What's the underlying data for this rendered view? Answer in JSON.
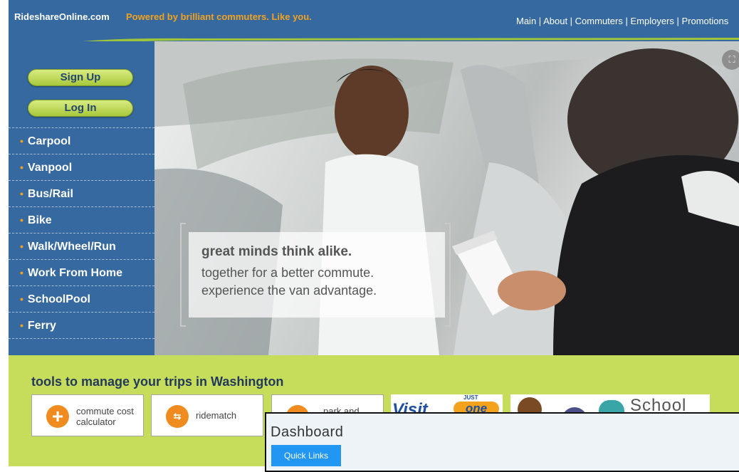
{
  "header": {
    "site_name": "RideshareOnline.com",
    "tagline": "Powered by brilliant commuters. Like you.",
    "nav": [
      "Main",
      "About",
      "Commuters",
      "Employers",
      "Promotions"
    ],
    "separator": " | "
  },
  "sidebar": {
    "sign_up": "Sign Up",
    "log_in": "Log In",
    "bullet": "•",
    "items": [
      "Carpool",
      "Vanpool",
      "Bus/Rail",
      "Bike",
      "Walk/Wheel/Run",
      "Work From Home",
      "SchoolPool",
      "Ferry"
    ]
  },
  "hero": {
    "line1": "great minds think alike.",
    "line2": "together for a better commute.",
    "line3": "experience the van advantage.",
    "expand_icon": "expand-icon"
  },
  "tools": {
    "heading": "tools to manage your trips in Washington",
    "items": [
      {
        "label": "commute cost calculator",
        "icon": "plus-icon"
      },
      {
        "label": "ridematch",
        "icon": "ridematch-icon"
      },
      {
        "label": "park and",
        "icon": "park-and-ride-icon"
      }
    ],
    "banners": [
      {
        "text": "Visit",
        "badge": "JUST",
        "word": "one"
      },
      {
        "text": "School"
      }
    ]
  },
  "dashboard": {
    "title": "Dashboard",
    "quick_links": "Quick Links"
  },
  "colors": {
    "header_blue": "#35699f",
    "accent_orange": "#f4a21d",
    "lime": "#c6dd5c",
    "button_blue": "#2196f3"
  }
}
